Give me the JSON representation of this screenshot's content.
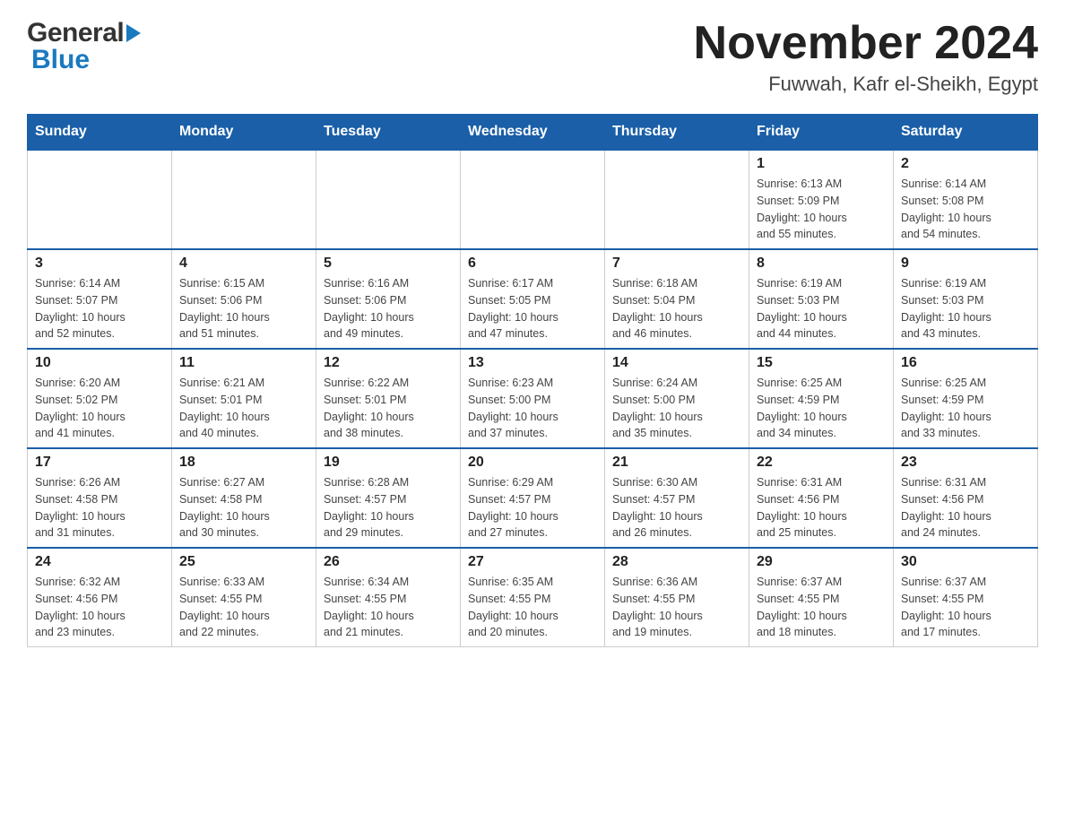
{
  "header": {
    "logo": {
      "general_text": "General",
      "blue_text": "Blue"
    },
    "title": "November 2024",
    "location": "Fuwwah, Kafr el-Sheikh, Egypt"
  },
  "weekdays": [
    "Sunday",
    "Monday",
    "Tuesday",
    "Wednesday",
    "Thursday",
    "Friday",
    "Saturday"
  ],
  "weeks": [
    {
      "days": [
        {
          "number": "",
          "info": ""
        },
        {
          "number": "",
          "info": ""
        },
        {
          "number": "",
          "info": ""
        },
        {
          "number": "",
          "info": ""
        },
        {
          "number": "",
          "info": ""
        },
        {
          "number": "1",
          "info": "Sunrise: 6:13 AM\nSunset: 5:09 PM\nDaylight: 10 hours\nand 55 minutes."
        },
        {
          "number": "2",
          "info": "Sunrise: 6:14 AM\nSunset: 5:08 PM\nDaylight: 10 hours\nand 54 minutes."
        }
      ]
    },
    {
      "days": [
        {
          "number": "3",
          "info": "Sunrise: 6:14 AM\nSunset: 5:07 PM\nDaylight: 10 hours\nand 52 minutes."
        },
        {
          "number": "4",
          "info": "Sunrise: 6:15 AM\nSunset: 5:06 PM\nDaylight: 10 hours\nand 51 minutes."
        },
        {
          "number": "5",
          "info": "Sunrise: 6:16 AM\nSunset: 5:06 PM\nDaylight: 10 hours\nand 49 minutes."
        },
        {
          "number": "6",
          "info": "Sunrise: 6:17 AM\nSunset: 5:05 PM\nDaylight: 10 hours\nand 47 minutes."
        },
        {
          "number": "7",
          "info": "Sunrise: 6:18 AM\nSunset: 5:04 PM\nDaylight: 10 hours\nand 46 minutes."
        },
        {
          "number": "8",
          "info": "Sunrise: 6:19 AM\nSunset: 5:03 PM\nDaylight: 10 hours\nand 44 minutes."
        },
        {
          "number": "9",
          "info": "Sunrise: 6:19 AM\nSunset: 5:03 PM\nDaylight: 10 hours\nand 43 minutes."
        }
      ]
    },
    {
      "days": [
        {
          "number": "10",
          "info": "Sunrise: 6:20 AM\nSunset: 5:02 PM\nDaylight: 10 hours\nand 41 minutes."
        },
        {
          "number": "11",
          "info": "Sunrise: 6:21 AM\nSunset: 5:01 PM\nDaylight: 10 hours\nand 40 minutes."
        },
        {
          "number": "12",
          "info": "Sunrise: 6:22 AM\nSunset: 5:01 PM\nDaylight: 10 hours\nand 38 minutes."
        },
        {
          "number": "13",
          "info": "Sunrise: 6:23 AM\nSunset: 5:00 PM\nDaylight: 10 hours\nand 37 minutes."
        },
        {
          "number": "14",
          "info": "Sunrise: 6:24 AM\nSunset: 5:00 PM\nDaylight: 10 hours\nand 35 minutes."
        },
        {
          "number": "15",
          "info": "Sunrise: 6:25 AM\nSunset: 4:59 PM\nDaylight: 10 hours\nand 34 minutes."
        },
        {
          "number": "16",
          "info": "Sunrise: 6:25 AM\nSunset: 4:59 PM\nDaylight: 10 hours\nand 33 minutes."
        }
      ]
    },
    {
      "days": [
        {
          "number": "17",
          "info": "Sunrise: 6:26 AM\nSunset: 4:58 PM\nDaylight: 10 hours\nand 31 minutes."
        },
        {
          "number": "18",
          "info": "Sunrise: 6:27 AM\nSunset: 4:58 PM\nDaylight: 10 hours\nand 30 minutes."
        },
        {
          "number": "19",
          "info": "Sunrise: 6:28 AM\nSunset: 4:57 PM\nDaylight: 10 hours\nand 29 minutes."
        },
        {
          "number": "20",
          "info": "Sunrise: 6:29 AM\nSunset: 4:57 PM\nDaylight: 10 hours\nand 27 minutes."
        },
        {
          "number": "21",
          "info": "Sunrise: 6:30 AM\nSunset: 4:57 PM\nDaylight: 10 hours\nand 26 minutes."
        },
        {
          "number": "22",
          "info": "Sunrise: 6:31 AM\nSunset: 4:56 PM\nDaylight: 10 hours\nand 25 minutes."
        },
        {
          "number": "23",
          "info": "Sunrise: 6:31 AM\nSunset: 4:56 PM\nDaylight: 10 hours\nand 24 minutes."
        }
      ]
    },
    {
      "days": [
        {
          "number": "24",
          "info": "Sunrise: 6:32 AM\nSunset: 4:56 PM\nDaylight: 10 hours\nand 23 minutes."
        },
        {
          "number": "25",
          "info": "Sunrise: 6:33 AM\nSunset: 4:55 PM\nDaylight: 10 hours\nand 22 minutes."
        },
        {
          "number": "26",
          "info": "Sunrise: 6:34 AM\nSunset: 4:55 PM\nDaylight: 10 hours\nand 21 minutes."
        },
        {
          "number": "27",
          "info": "Sunrise: 6:35 AM\nSunset: 4:55 PM\nDaylight: 10 hours\nand 20 minutes."
        },
        {
          "number": "28",
          "info": "Sunrise: 6:36 AM\nSunset: 4:55 PM\nDaylight: 10 hours\nand 19 minutes."
        },
        {
          "number": "29",
          "info": "Sunrise: 6:37 AM\nSunset: 4:55 PM\nDaylight: 10 hours\nand 18 minutes."
        },
        {
          "number": "30",
          "info": "Sunrise: 6:37 AM\nSunset: 4:55 PM\nDaylight: 10 hours\nand 17 minutes."
        }
      ]
    }
  ]
}
